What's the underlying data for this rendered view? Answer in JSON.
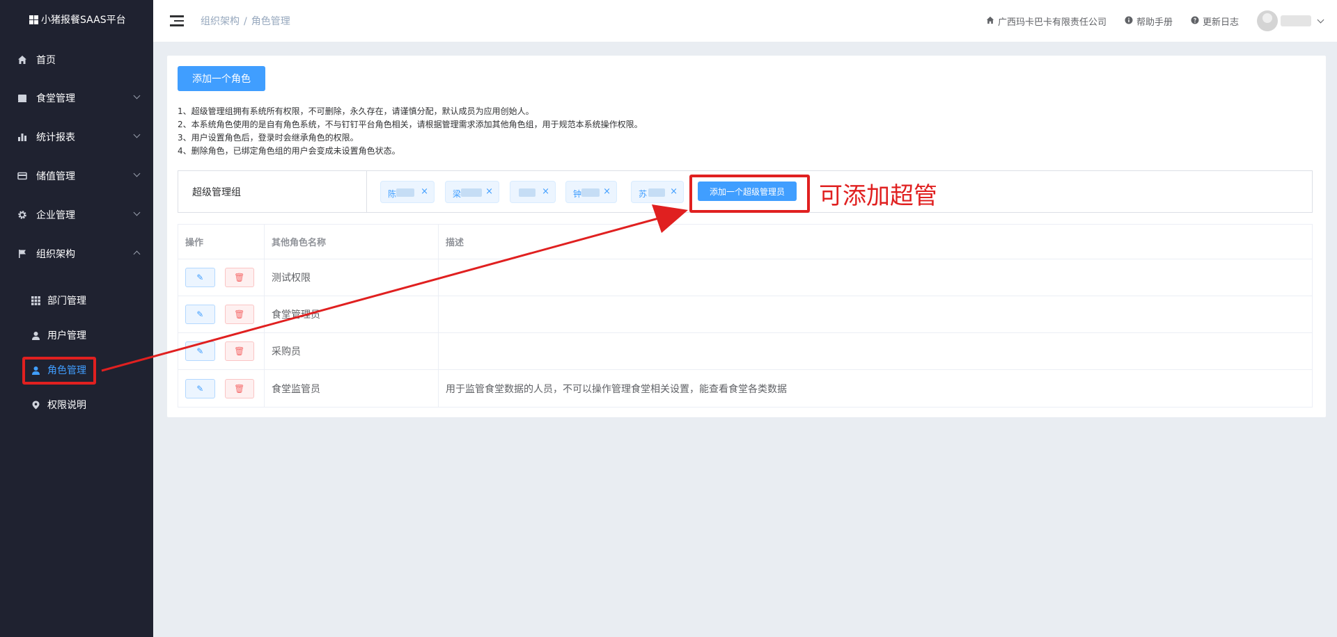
{
  "app": {
    "title": "小猪报餐SAAS平台"
  },
  "sidebar": {
    "items": [
      {
        "label": "首页",
        "icon": "home-icon"
      },
      {
        "label": "食堂管理",
        "icon": "canteen-icon"
      },
      {
        "label": "统计报表",
        "icon": "bar-chart-icon"
      },
      {
        "label": "储值管理",
        "icon": "card-icon"
      },
      {
        "label": "企业管理",
        "icon": "gear-icon"
      },
      {
        "label": "组织架构",
        "icon": "flag-icon"
      }
    ],
    "sub_items": [
      {
        "label": "部门管理",
        "icon": "grid-icon"
      },
      {
        "label": "用户管理",
        "icon": "user-icon"
      },
      {
        "label": "角色管理",
        "icon": "user-icon",
        "active": true
      },
      {
        "label": "权限说明",
        "icon": "location-icon"
      }
    ]
  },
  "header": {
    "breadcrumb": [
      "组织架构",
      "角色管理"
    ],
    "company": "广西玛卡巴卡有限责任公司",
    "help": "帮助手册",
    "changelog": "更新日志"
  },
  "main": {
    "add_role_button": "添加一个角色",
    "notes": [
      "1、超级管理组拥有系统所有权限，不可删除，永久存在，请谨慎分配，默认成员为应用创始人。",
      "2、本系统角色使用的是自有角色系统，不与钉钉平台角色相关，请根据管理需求添加其他角色组，用于规范本系统操作权限。",
      "3、用户设置角色后，登录时会继承角色的权限。",
      "4、删除角色，已绑定角色组的用户会变成未设置角色状态。"
    ],
    "super_group": {
      "label": "超级管理组",
      "members": [
        "陈",
        "梁",
        "",
        "钟",
        "苏"
      ],
      "add_button": "添加一个超级管理员"
    },
    "table": {
      "headers": [
        "操作",
        "其他角色名称",
        "描述"
      ],
      "rows": [
        {
          "name": "测试权限",
          "desc": ""
        },
        {
          "name": "食堂管理员",
          "desc": ""
        },
        {
          "name": "采购员",
          "desc": ""
        },
        {
          "name": "食堂监管员",
          "desc": "用于监管食堂数据的人员，不可以操作管理食堂相关设置，能查看食堂各类数据"
        }
      ]
    }
  },
  "annotation": {
    "text": "可添加超管",
    "color": "#e02020"
  },
  "colors": {
    "primary": "#409eff",
    "sidebar_bg": "#1f2230",
    "danger": "#f56c6c"
  }
}
